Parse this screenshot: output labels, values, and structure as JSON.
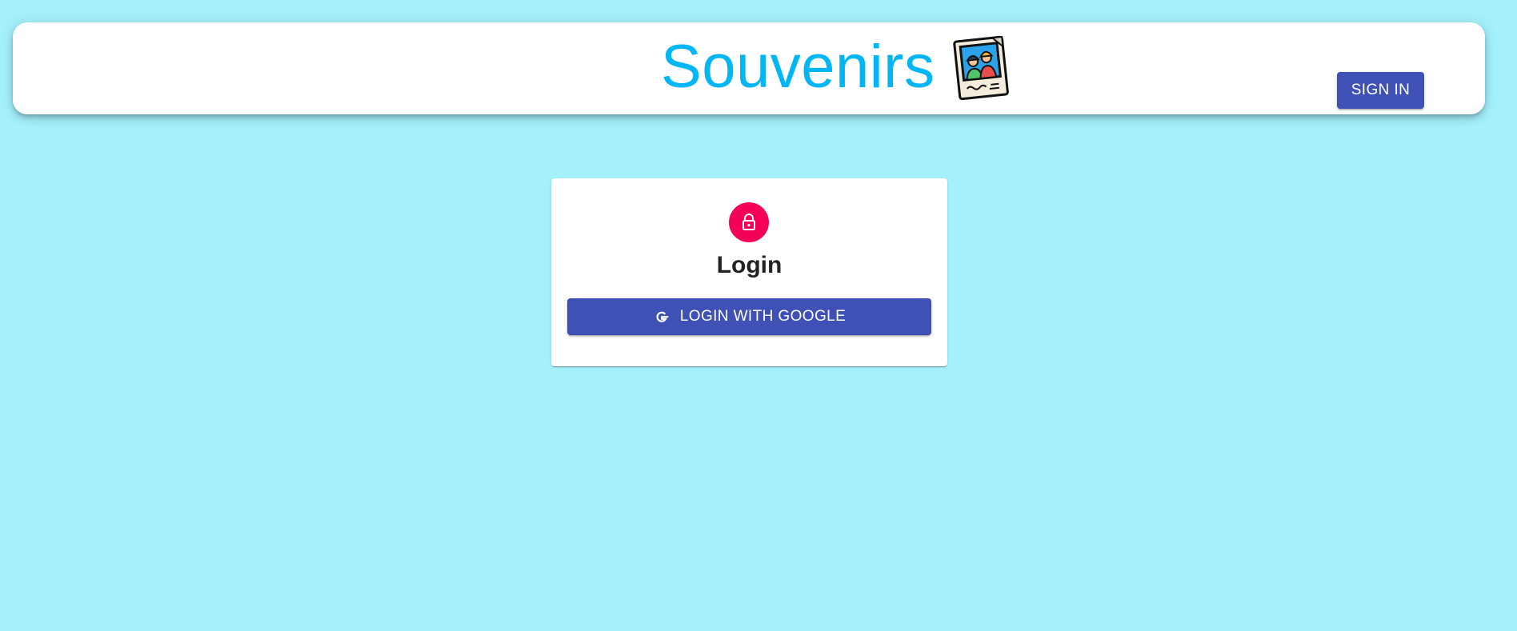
{
  "header": {
    "title": "Souvenirs",
    "logo_icon": "photo-polaroid-icon",
    "signin_label": "SIGN IN"
  },
  "login_card": {
    "icon": "lock-icon",
    "title": "Login",
    "google_button_label": "LOGIN WITH GOOGLE",
    "google_icon": "google-icon"
  },
  "colors": {
    "background": "#a4f1fc",
    "brand_title": "#00b6f5",
    "primary_button": "#3f51b5",
    "lock_avatar": "#f50057"
  }
}
